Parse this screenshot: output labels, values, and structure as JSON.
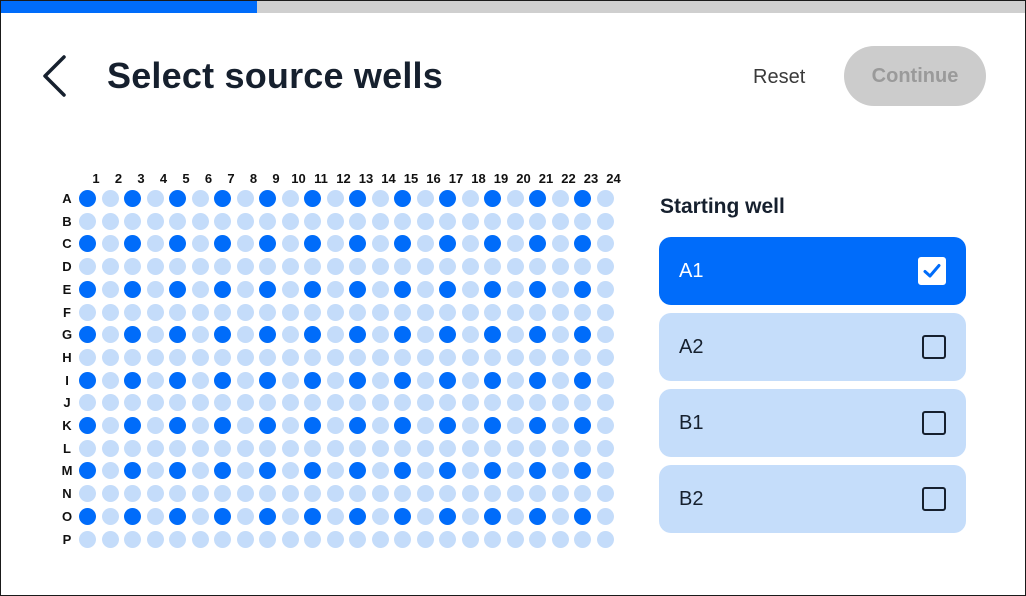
{
  "progress": {
    "fraction": 0.25,
    "color": "#006cfa"
  },
  "header": {
    "back_icon": "chevron-left-icon",
    "title": "Select source wells",
    "reset_label": "Reset",
    "continue_label": "Continue",
    "continue_disabled": true
  },
  "plate": {
    "columns": [
      "1",
      "2",
      "3",
      "4",
      "5",
      "6",
      "7",
      "8",
      "9",
      "10",
      "11",
      "12",
      "13",
      "14",
      "15",
      "16",
      "17",
      "18",
      "19",
      "20",
      "21",
      "22",
      "23",
      "24"
    ],
    "rows": [
      "A",
      "B",
      "C",
      "D",
      "E",
      "F",
      "G",
      "H",
      "I",
      "J",
      "K",
      "L",
      "M",
      "N",
      "O",
      "P"
    ],
    "filled_rows": [
      "A",
      "C",
      "E",
      "G",
      "I",
      "K",
      "M",
      "O"
    ],
    "filled_columns": [
      "1",
      "3",
      "5",
      "7",
      "9",
      "11",
      "13",
      "15",
      "17",
      "19",
      "21",
      "23"
    ],
    "filled_color": "#006cfa",
    "empty_color": "#c4dcfa"
  },
  "starting_well": {
    "heading": "Starting well",
    "options": [
      {
        "label": "A1",
        "selected": true
      },
      {
        "label": "A2",
        "selected": false
      },
      {
        "label": "B1",
        "selected": false
      },
      {
        "label": "B2",
        "selected": false
      }
    ]
  }
}
